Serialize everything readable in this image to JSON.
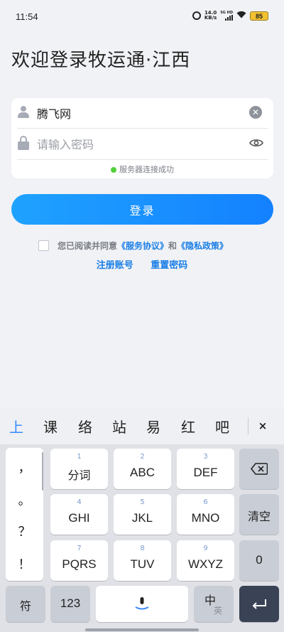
{
  "status_bar": {
    "time": "11:54",
    "net_speed_value": "14.0",
    "net_speed_unit": "KB/s",
    "signal_label": "5G HD",
    "battery": "85"
  },
  "title": "欢迎登录牧运通·江西",
  "login": {
    "username_value": "腾飞网",
    "password_placeholder": "请输入密码",
    "server_status": "服务器连接成功",
    "login_button": "登录"
  },
  "agreement": {
    "prefix": "您已阅读并同意",
    "service_link": "《服务协议》",
    "conjunction": "和",
    "privacy_link": "《隐私政策》"
  },
  "links": {
    "register": "注册账号",
    "reset_password": "重置密码"
  },
  "keyboard": {
    "candidates": [
      "上",
      "课",
      "络",
      "站",
      "易",
      "红",
      "吧"
    ],
    "close": "×",
    "punctuation": [
      "，",
      "。",
      "？",
      "！"
    ],
    "keys": [
      {
        "num": "1",
        "label": "分词"
      },
      {
        "num": "2",
        "label": "ABC"
      },
      {
        "num": "3",
        "label": "DEF"
      },
      {
        "num": "4",
        "label": "GHI"
      },
      {
        "num": "5",
        "label": "JKL"
      },
      {
        "num": "6",
        "label": "MNO"
      },
      {
        "num": "7",
        "label": "PQRS"
      },
      {
        "num": "8",
        "label": "TUV"
      },
      {
        "num": "9",
        "label": "WXYZ"
      }
    ],
    "clear": "清空",
    "zero": "0",
    "symbol": "符",
    "numeric": "123",
    "lang_primary": "中",
    "lang_secondary": "英"
  },
  "colors": {
    "accent": "#1a7fe6",
    "button_start": "#1fa2ff",
    "button_end": "#1481ff",
    "status_ok": "#52d13a"
  }
}
